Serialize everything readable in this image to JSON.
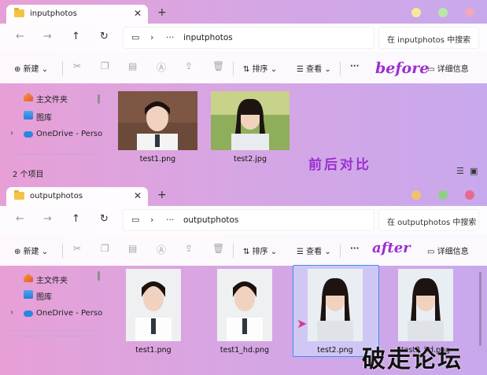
{
  "window1": {
    "tab_title": "inputphotos",
    "address": "inputphotos",
    "search_placeholder": "在 inputphotos 中搜索",
    "status": "2 个项目",
    "files": [
      {
        "name": "test1.png"
      },
      {
        "name": "test2.jpg"
      }
    ]
  },
  "window2": {
    "tab_title": "outputphotos",
    "address": "outputphotos",
    "search_placeholder": "在 outputphotos 中搜索",
    "files": [
      {
        "name": "test1.png"
      },
      {
        "name": "test1_hd.png"
      },
      {
        "name": "test2.png"
      },
      {
        "name": "test2_hd.png"
      }
    ]
  },
  "toolbar": {
    "new_label": "新建",
    "sort_label": "排序",
    "view_label": "查看",
    "more_label": "···",
    "details_label": "详细信息"
  },
  "sidebar": {
    "items": [
      {
        "label": "主文件夹",
        "icon": "home-icon"
      },
      {
        "label": "图库",
        "icon": "gallery-icon"
      },
      {
        "label": "OneDrive - Perso",
        "icon": "cloud-icon"
      }
    ]
  },
  "annotations": {
    "before": "before",
    "compare": "前后对比",
    "after": "after"
  },
  "brand_watermark": "破走论坛",
  "colors": {
    "accent_purple": "#9b2fd0",
    "selection_blue": "#3b8ff5",
    "folder_yellow": "#f3c343"
  }
}
